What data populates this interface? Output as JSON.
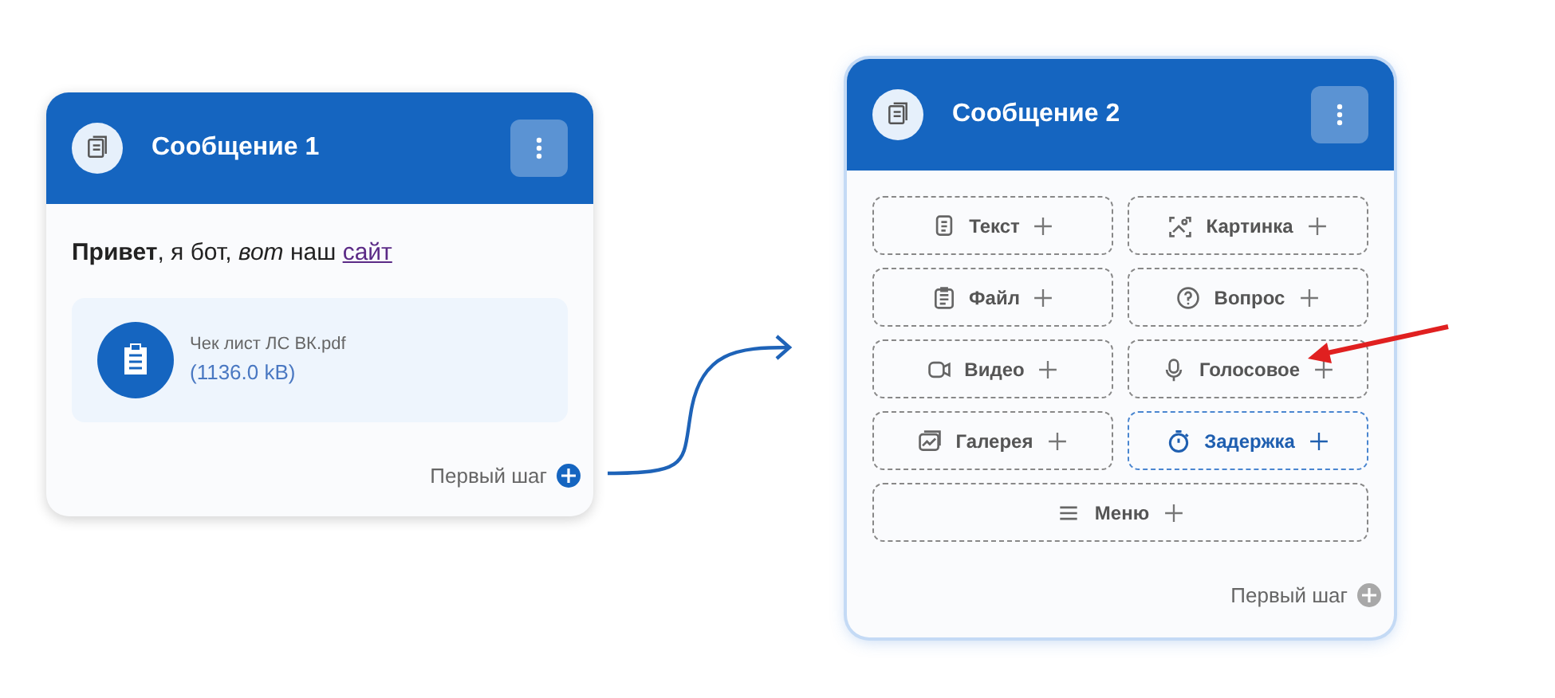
{
  "nodes": [
    {
      "title": "Сообщение 1",
      "selected": false,
      "message": {
        "text": "**Привет**, я бот, *вот* наш",
        "link": "сайт"
      },
      "attachment": {
        "filename": "Чек лист ЛС ВК.pdf",
        "size": "(1136.0 kB)"
      },
      "port": {
        "label": "Первый шаг",
        "connected": true
      }
    },
    {
      "title": "Сообщение 2",
      "selected": true,
      "buttons": [
        {
          "kind": "text",
          "label": "Текст",
          "highlighted": false
        },
        {
          "kind": "image",
          "label": "Картинка",
          "highlighted": false
        },
        {
          "kind": "file",
          "label": "Файл",
          "highlighted": false
        },
        {
          "kind": "question",
          "label": "Вопрос",
          "highlighted": false
        },
        {
          "kind": "video",
          "label": "Видео",
          "highlighted": false
        },
        {
          "kind": "voice",
          "label": "Голосовое",
          "highlighted": false
        },
        {
          "kind": "gallery",
          "label": "Галерея",
          "highlighted": false
        },
        {
          "kind": "delay",
          "label": "Задержка",
          "highlighted": true
        },
        {
          "kind": "menu",
          "label": "Меню",
          "highlighted": false,
          "wide": true
        }
      ],
      "port": {
        "label": "Первый шаг",
        "connected": false
      }
    }
  ]
}
